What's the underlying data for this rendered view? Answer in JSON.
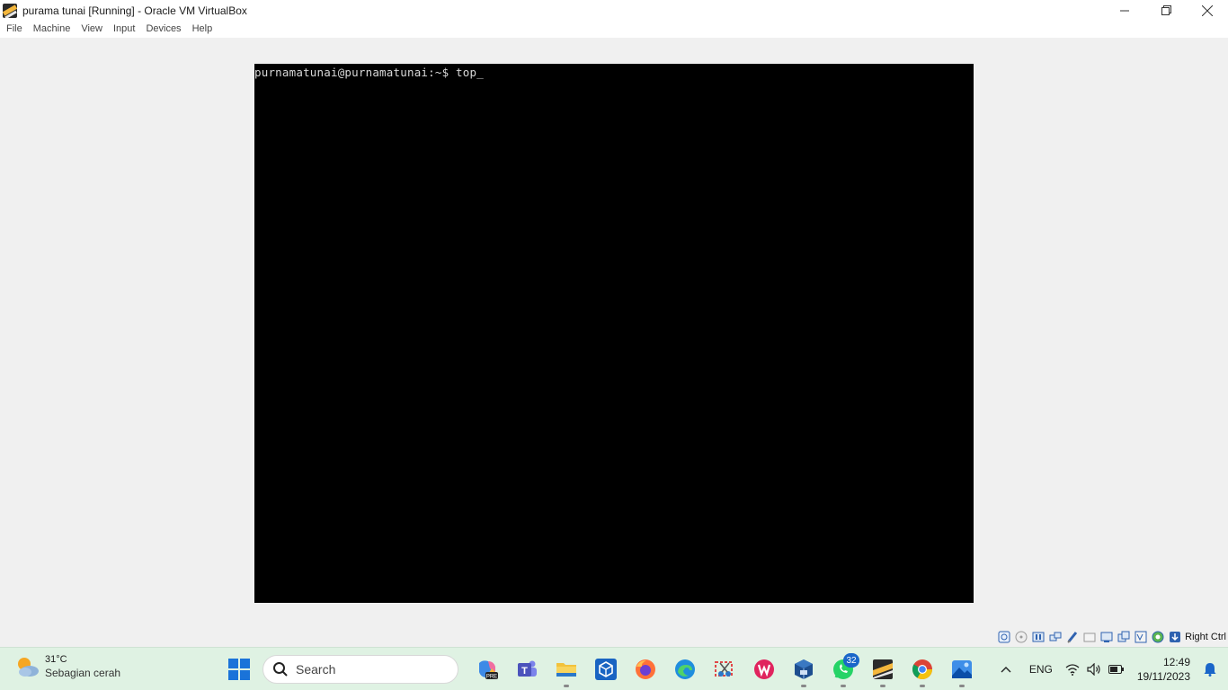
{
  "window": {
    "title": "purama tunai [Running] - Oracle VM VirtualBox"
  },
  "menu": {
    "items": [
      "File",
      "Machine",
      "View",
      "Input",
      "Devices",
      "Help"
    ]
  },
  "vm": {
    "terminal_line": "purnamatunai@purnamatunai:~$ top_"
  },
  "statusbar": {
    "icons": [
      "hard-disk-icon",
      "optical-drive-icon",
      "audio-icon",
      "network-icon",
      "usb-icon",
      "shared-folders-icon",
      "display-icon",
      "recording-icon",
      "cpu-icon",
      "mouse-integration-icon",
      "keyboard-capture-icon"
    ],
    "host_key": "Right Ctrl"
  },
  "taskbar": {
    "weather": {
      "temperature": "31°C",
      "description": "Sebagian cerah"
    },
    "search": {
      "placeholder": "Search"
    },
    "apps": [
      {
        "name": "copilot-pre-app"
      },
      {
        "name": "teams-app"
      },
      {
        "name": "file-explorer-app",
        "running": true
      },
      {
        "name": "codesandbox-app"
      },
      {
        "name": "firefox-app"
      },
      {
        "name": "edge-app"
      },
      {
        "name": "snipping-tool-app"
      },
      {
        "name": "wps-office-app"
      },
      {
        "name": "virtualbox-app",
        "running": true
      },
      {
        "name": "whatsapp-app",
        "badge": "32",
        "running": true
      },
      {
        "name": "vm-window-app",
        "running": true
      },
      {
        "name": "chrome-app",
        "running": true
      },
      {
        "name": "photos-app",
        "running": true
      }
    ],
    "tray": {
      "language": "ENG",
      "time": "12:49",
      "date": "19/11/2023"
    }
  },
  "colors": {
    "taskbar_bg": "#dff2e3",
    "vm_screen_bg": "#000000",
    "accent": "#1a73d9"
  }
}
